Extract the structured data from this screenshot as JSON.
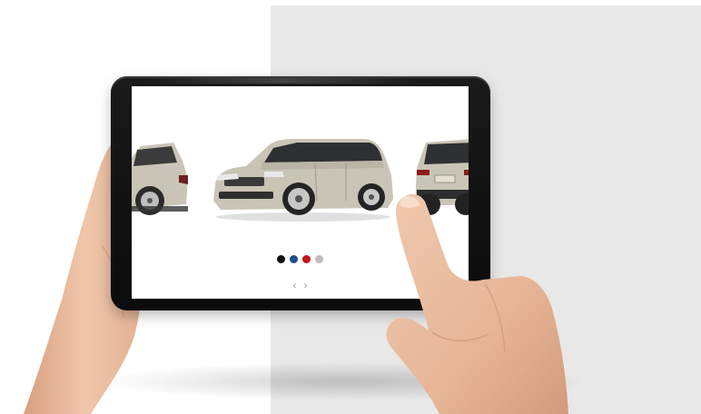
{
  "colors": {
    "background_panel": "#e8e8e8",
    "tablet_bezel": "#111111",
    "screen": "#ffffff",
    "car_body": "#c9c5b6",
    "skin": "#e8b99a"
  },
  "carousel": {
    "swatches": [
      {
        "name": "black",
        "color": "#111111"
      },
      {
        "name": "blue",
        "color": "#1f4f8c"
      },
      {
        "name": "red",
        "color": "#c0141a"
      },
      {
        "name": "silver",
        "color": "#bdbdbd"
      }
    ],
    "prev_icon": "‹",
    "next_icon": "›"
  },
  "icons": {
    "prev": "chevron-left-icon",
    "next": "chevron-right-icon"
  }
}
